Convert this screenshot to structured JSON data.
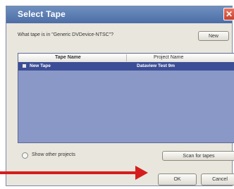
{
  "dialog": {
    "title": "Select Tape",
    "close_glyph": "✕",
    "question": "What tape is in \"Generic DVDevice-NTSC\"?",
    "new_button": "New"
  },
  "table": {
    "headers": [
      "Tape Name",
      "Project Name"
    ],
    "rows": [
      {
        "tape_name": "New Tape",
        "project_name": "Dataview Test 9m"
      }
    ],
    "row_icon": "tape-icon",
    "selection_color": "#3c4e96",
    "list_background": "#8a98c8"
  },
  "options": {
    "show_other_projects": "Show other projects",
    "scan_button": "Scan for tapes"
  },
  "footer": {
    "ok": "OK",
    "cancel": "Cancel"
  },
  "annotation": {
    "arrow_color": "#d51d1d"
  }
}
